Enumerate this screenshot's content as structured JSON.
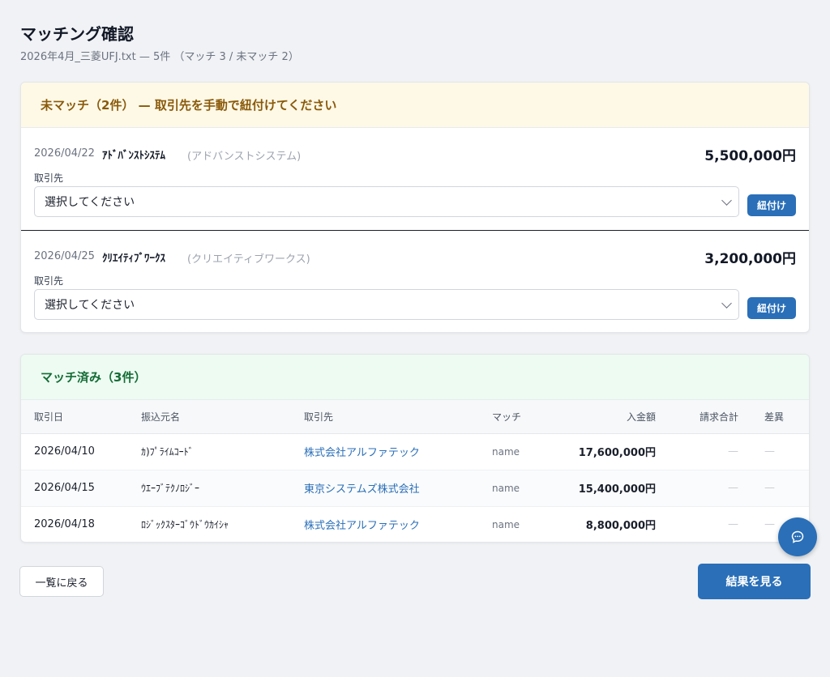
{
  "header": {
    "title": "マッチング確認",
    "subtitle": "2026年4月_三菱UFJ.txt — 5件 （マッチ 3 / 未マッチ 2）"
  },
  "unmatched": {
    "heading": "未マッチ（2件） — 取引先を手動で紐付けてください",
    "rows": [
      {
        "date": "2026/04/22",
        "name": "ｱﾄﾞﾊﾞﾝｽﾄｼｽﾃﾑ",
        "kana": "(アドバンストシステム)",
        "amount": "5,500,000円",
        "label": "取引先",
        "select_value": "選択してください",
        "button": "紐付け"
      },
      {
        "date": "2026/04/25",
        "name": "ｸﾘｴｲﾃｨﾌﾞﾜｰｸｽ",
        "kana": "(クリエイティブワークス)",
        "amount": "3,200,000円",
        "label": "取引先",
        "select_value": "選択してください",
        "button": "紐付け"
      }
    ]
  },
  "matched": {
    "heading": "マッチ済み（3件）",
    "columns": [
      "取引日",
      "振込元名",
      "取引先",
      "マッチ",
      "入金額",
      "請求合計",
      "差異"
    ],
    "rows": [
      {
        "date": "2026/04/10",
        "payer": "ｶ)ﾌﾟﾗｲﾑｺｰﾄﾞ",
        "client": "株式会社アルファテック",
        "match": "name",
        "amount": "17,600,000円",
        "invoice": "—",
        "diff": "—"
      },
      {
        "date": "2026/04/15",
        "payer": "ｳｴｰﾌﾞﾃｸﾉﾛｼﾞｰ",
        "client": "東京システムズ株式会社",
        "match": "name",
        "amount": "15,400,000円",
        "invoice": "—",
        "diff": "—"
      },
      {
        "date": "2026/04/18",
        "payer": "ﾛｼﾞｯｸｽﾀｰｺﾞｳﾄﾞｳｶｲｼｬ",
        "client": "株式会社アルファテック",
        "match": "name",
        "amount": "8,800,000円",
        "invoice": "—",
        "diff": "—"
      }
    ]
  },
  "footer": {
    "back_label": "一覧に戻る",
    "result_label": "結果を見る"
  },
  "icons": {
    "chat": "chat-bubble-icon",
    "dropdown": "chevron-down-icon"
  },
  "colors": {
    "primary": "#2a6fb8",
    "unmatched_bg": "#fef9e7",
    "unmatched_text": "#8a5a0a",
    "matched_bg": "#edfbf2",
    "matched_text": "#146c35"
  }
}
